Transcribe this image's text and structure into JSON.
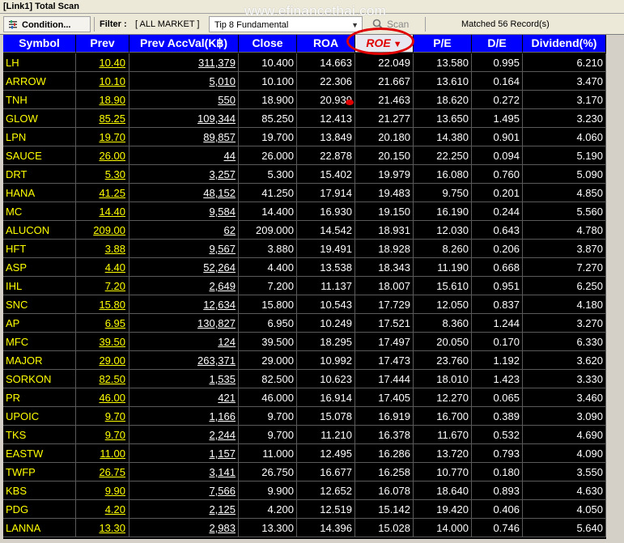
{
  "window": {
    "title": "[Link1] Total Scan"
  },
  "watermark": "www.efinancethai.com",
  "toolbar": {
    "condition_label": "Condition...",
    "filter_label": "Filter :",
    "filter_value": "[ ALL MARKET ]",
    "preset_value": "Tip 8 Fundamental",
    "scan_label": "Scan",
    "matched_text": "Matched 56 Record(s)"
  },
  "columns": {
    "symbol": "Symbol",
    "prev": "Prev",
    "acc": "Prev AccVal(K฿)",
    "close": "Close",
    "roa": "ROA",
    "roe": "ROE",
    "pe": "P/E",
    "de": "D/E",
    "div": "Dividend(%)"
  },
  "sort": {
    "column": "ROE",
    "direction": "descending"
  },
  "colors": {
    "header_bg": "#0000ff",
    "grid_bg": "#000000",
    "symbol_text": "#ffff00",
    "value_text": "#ffffff",
    "highlight": "#e00000"
  },
  "rows": [
    {
      "symbol": "LH",
      "prev": "10.40",
      "acc": "311,379",
      "close": "10.400",
      "roa": "14.663",
      "roe": "22.049",
      "pe": "13.580",
      "de": "0.995",
      "div": "6.210"
    },
    {
      "symbol": "ARROW",
      "prev": "10.10",
      "acc": "5,010",
      "close": "10.100",
      "roa": "22.306",
      "roe": "21.667",
      "pe": "13.610",
      "de": "0.164",
      "div": "3.470"
    },
    {
      "symbol": "TNH",
      "prev": "18.90",
      "acc": "550",
      "close": "18.900",
      "roa": "20.939",
      "roe": "21.463",
      "pe": "18.620",
      "de": "0.272",
      "div": "3.170"
    },
    {
      "symbol": "GLOW",
      "prev": "85.25",
      "acc": "109,344",
      "close": "85.250",
      "roa": "12.413",
      "roe": "21.277",
      "pe": "13.650",
      "de": "1.495",
      "div": "3.230"
    },
    {
      "symbol": "LPN",
      "prev": "19.70",
      "acc": "89,857",
      "close": "19.700",
      "roa": "13.849",
      "roe": "20.180",
      "pe": "14.380",
      "de": "0.901",
      "div": "4.060"
    },
    {
      "symbol": "SAUCE",
      "prev": "26.00",
      "acc": "44",
      "close": "26.000",
      "roa": "22.878",
      "roe": "20.150",
      "pe": "22.250",
      "de": "0.094",
      "div": "5.190"
    },
    {
      "symbol": "DRT",
      "prev": "5.30",
      "acc": "3,257",
      "close": "5.300",
      "roa": "15.402",
      "roe": "19.979",
      "pe": "16.080",
      "de": "0.760",
      "div": "5.090"
    },
    {
      "symbol": "HANA",
      "prev": "41.25",
      "acc": "48,152",
      "close": "41.250",
      "roa": "17.914",
      "roe": "19.483",
      "pe": "9.750",
      "de": "0.201",
      "div": "4.850"
    },
    {
      "symbol": "MC",
      "prev": "14.40",
      "acc": "9,584",
      "close": "14.400",
      "roa": "16.930",
      "roe": "19.150",
      "pe": "16.190",
      "de": "0.244",
      "div": "5.560"
    },
    {
      "symbol": "ALUCON",
      "prev": "209.00",
      "acc": "62",
      "close": "209.000",
      "roa": "14.542",
      "roe": "18.931",
      "pe": "12.030",
      "de": "0.643",
      "div": "4.780"
    },
    {
      "symbol": "HFT",
      "prev": "3.88",
      "acc": "9,567",
      "close": "3.880",
      "roa": "19.491",
      "roe": "18.928",
      "pe": "8.260",
      "de": "0.206",
      "div": "3.870"
    },
    {
      "symbol": "ASP",
      "prev": "4.40",
      "acc": "52,264",
      "close": "4.400",
      "roa": "13.538",
      "roe": "18.343",
      "pe": "11.190",
      "de": "0.668",
      "div": "7.270"
    },
    {
      "symbol": "IHL",
      "prev": "7.20",
      "acc": "2,649",
      "close": "7.200",
      "roa": "11.137",
      "roe": "18.007",
      "pe": "15.610",
      "de": "0.951",
      "div": "6.250"
    },
    {
      "symbol": "SNC",
      "prev": "15.80",
      "acc": "12,634",
      "close": "15.800",
      "roa": "10.543",
      "roe": "17.729",
      "pe": "12.050",
      "de": "0.837",
      "div": "4.180"
    },
    {
      "symbol": "AP",
      "prev": "6.95",
      "acc": "130,827",
      "close": "6.950",
      "roa": "10.249",
      "roe": "17.521",
      "pe": "8.360",
      "de": "1.244",
      "div": "3.270"
    },
    {
      "symbol": "MFC",
      "prev": "39.50",
      "acc": "124",
      "close": "39.500",
      "roa": "18.295",
      "roe": "17.497",
      "pe": "20.050",
      "de": "0.170",
      "div": "6.330"
    },
    {
      "symbol": "MAJOR",
      "prev": "29.00",
      "acc": "263,371",
      "close": "29.000",
      "roa": "10.992",
      "roe": "17.473",
      "pe": "23.760",
      "de": "1.192",
      "div": "3.620"
    },
    {
      "symbol": "SORKON",
      "prev": "82.50",
      "acc": "1,535",
      "close": "82.500",
      "roa": "10.623",
      "roe": "17.444",
      "pe": "18.010",
      "de": "1.423",
      "div": "3.330"
    },
    {
      "symbol": "PR",
      "prev": "46.00",
      "acc": "421",
      "close": "46.000",
      "roa": "16.914",
      "roe": "17.405",
      "pe": "12.270",
      "de": "0.065",
      "div": "3.460"
    },
    {
      "symbol": "UPOIC",
      "prev": "9.70",
      "acc": "1,166",
      "close": "9.700",
      "roa": "15.078",
      "roe": "16.919",
      "pe": "16.700",
      "de": "0.389",
      "div": "3.090"
    },
    {
      "symbol": "TKS",
      "prev": "9.70",
      "acc": "2,244",
      "close": "9.700",
      "roa": "11.210",
      "roe": "16.378",
      "pe": "11.670",
      "de": "0.532",
      "div": "4.690"
    },
    {
      "symbol": "EASTW",
      "prev": "11.00",
      "acc": "1,157",
      "close": "11.000",
      "roa": "12.495",
      "roe": "16.286",
      "pe": "13.720",
      "de": "0.793",
      "div": "4.090"
    },
    {
      "symbol": "TWFP",
      "prev": "26.75",
      "acc": "3,141",
      "close": "26.750",
      "roa": "16.677",
      "roe": "16.258",
      "pe": "10.770",
      "de": "0.180",
      "div": "3.550"
    },
    {
      "symbol": "KBS",
      "prev": "9.90",
      "acc": "7,566",
      "close": "9.900",
      "roa": "12.652",
      "roe": "16.078",
      "pe": "18.640",
      "de": "0.893",
      "div": "4.630"
    },
    {
      "symbol": "PDG",
      "prev": "4.20",
      "acc": "2,125",
      "close": "4.200",
      "roa": "12.519",
      "roe": "15.142",
      "pe": "19.420",
      "de": "0.406",
      "div": "4.050"
    },
    {
      "symbol": "LANNA",
      "prev": "13.30",
      "acc": "2,983",
      "close": "13.300",
      "roa": "14.396",
      "roe": "15.028",
      "pe": "14.000",
      "de": "0.746",
      "div": "5.640"
    }
  ]
}
